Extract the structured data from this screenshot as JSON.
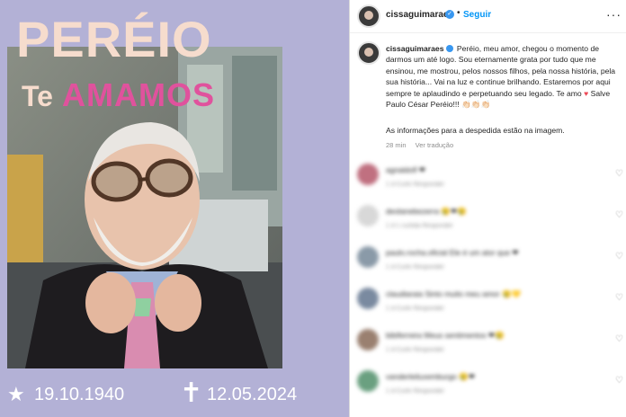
{
  "post_image": {
    "title_line1": "PERÉIO",
    "title_te": "Te",
    "title_amamos": "AMAMOS",
    "birth_symbol": "★",
    "birth_date": "19.10.1940",
    "death_symbol": "✝",
    "death_date": "12.05.2024"
  },
  "header": {
    "username": "cissaguimaraes",
    "verified_icon": "✓",
    "separator": "•",
    "follow_label": "Seguir",
    "more_icon": "···"
  },
  "caption": {
    "username": "cissaguimaraes",
    "text_1": "Peréio, meu amor, chegou o momento de darmos um até logo. Sou eternamente grata por tudo que me ensinou, me mostrou, pelos nossos filhos, pela nossa história, pela sua história... Vai na luz e continue brilhando. Estaremos por aqui sempre te aplaudindo e perpetuando seu legado. Te amo",
    "heart": "♥",
    "text_2": "Salve Paulo César Peréio!!!",
    "emojis": "👏🏻👏🏻👏🏻",
    "note": "As informações para a despedida estão na imagem.",
    "time": "28 min",
    "translate": "Ver tradução"
  },
  "comments": [
    {
      "text": "agnaldofl ❤",
      "meta": "1 d   Curtir   Responder",
      "avatar_color": "#c07080"
    },
    {
      "text": "deolanebezerra 😢❤😢",
      "meta": "1 d   1 curtida   Responder",
      "avatar_color": "#d8d8d8"
    },
    {
      "text": "paulo.rocha.oficial Ele é um ator que ❤",
      "meta": "1 d   Curtir   Responder",
      "avatar_color": "#8a9aa8"
    },
    {
      "text": "claudiaraia Sinto muito meu amor 😢💛",
      "meta": "1 d   Curtir   Responder",
      "avatar_color": "#7a8aa0"
    },
    {
      "text": "bibiferreira Meus sentimentos ❤😢",
      "meta": "1 d   Curtir   Responder",
      "avatar_color": "#9a8070"
    },
    {
      "text": "vanderleiluxemburgo 😢❤",
      "meta": "1 d   Curtir   Responder",
      "avatar_color": "#6aa080"
    }
  ],
  "comment_heart_icon": "♡"
}
